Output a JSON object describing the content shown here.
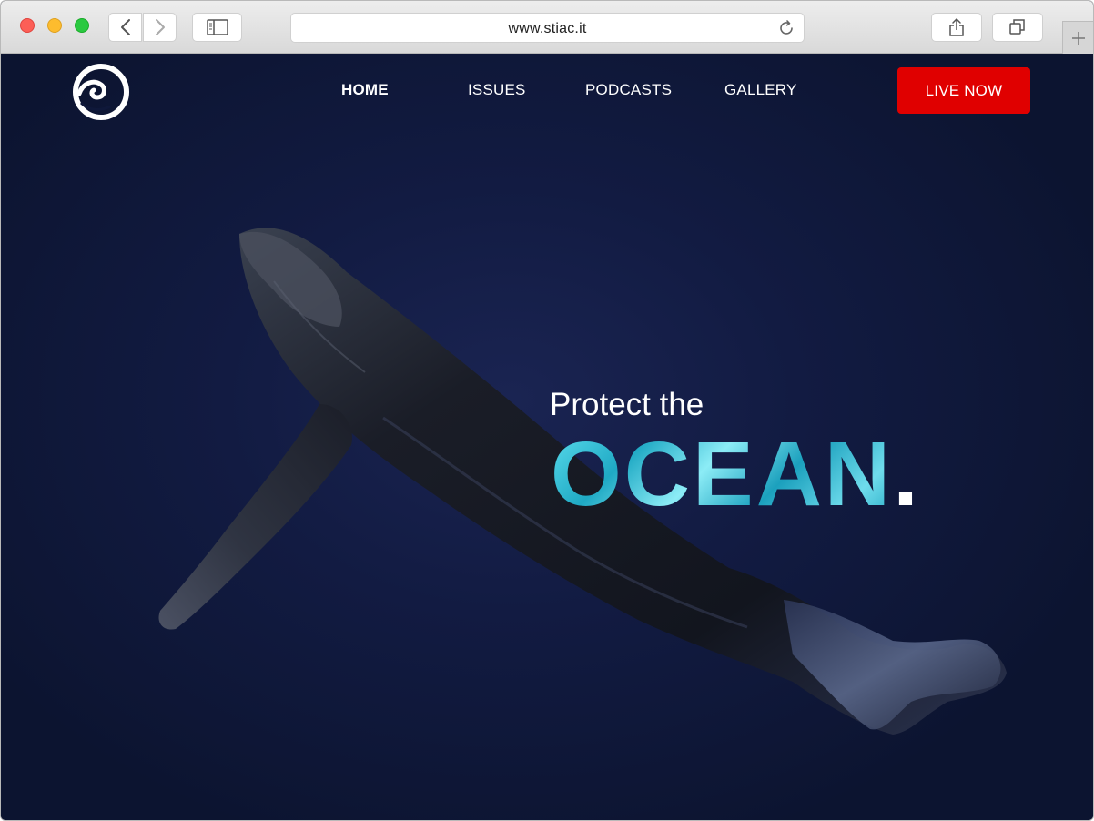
{
  "browser": {
    "url": "www.stiac.it",
    "icons": {
      "back": "chevron-left-icon",
      "forward": "chevron-right-icon",
      "sidebar": "sidebar-icon",
      "reload": "reload-icon",
      "share": "share-icon",
      "tabs": "tabs-icon",
      "new_tab": "plus-icon"
    }
  },
  "site": {
    "logo_icon": "wave-logo-icon",
    "nav": [
      {
        "label": "HOME",
        "active": true
      },
      {
        "label": "ISSUES",
        "active": false
      },
      {
        "label": "PODCASTS",
        "active": false
      },
      {
        "label": "GALLERY",
        "active": false
      }
    ],
    "cta_label": "LIVE NOW",
    "cta_color": "#e00000"
  },
  "hero": {
    "kicker": "Protect the",
    "title_word": "OCEAN",
    "title_dot": ".",
    "title_color": "#2bb5cc",
    "background_color": "#121b42",
    "image": "whale-illustration"
  }
}
